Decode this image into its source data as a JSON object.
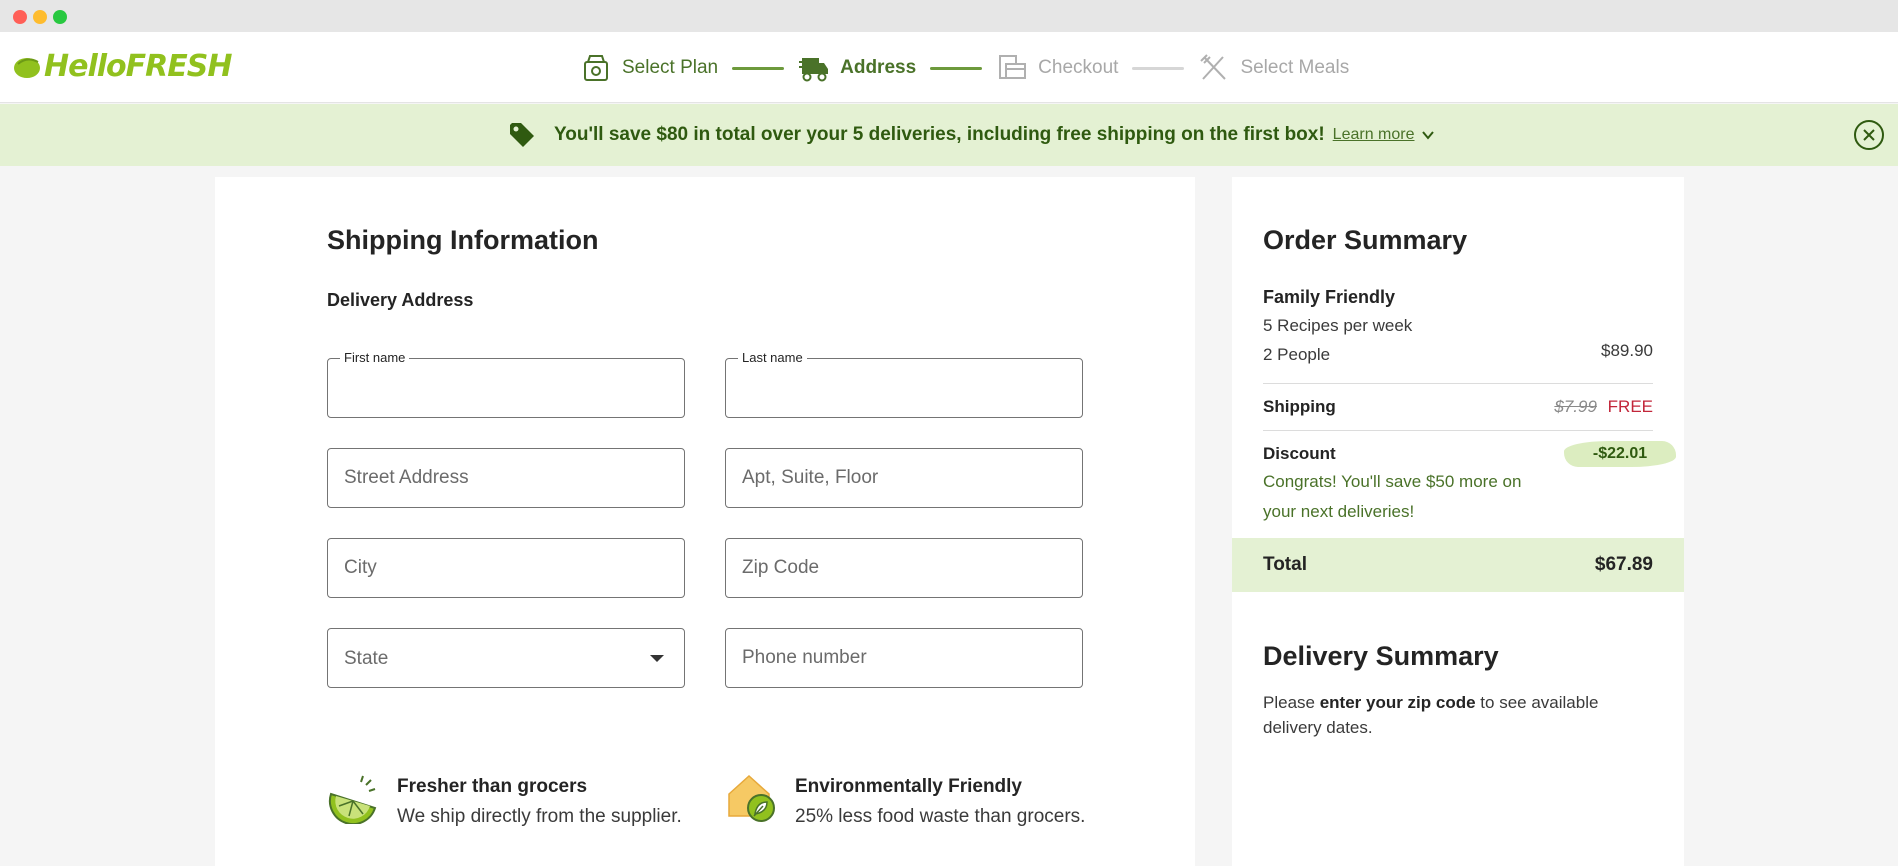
{
  "header": {
    "logo_text": "HelloFRESH",
    "steps": [
      {
        "label": "Select Plan",
        "state": "done",
        "icon": "box-icon"
      },
      {
        "label": "Address",
        "state": "active",
        "icon": "truck-icon"
      },
      {
        "label": "Checkout",
        "state": "pending",
        "icon": "checkout-icon"
      },
      {
        "label": "Select Meals",
        "state": "pending",
        "icon": "utensils-icon"
      }
    ]
  },
  "banner": {
    "text": "You'll save $80 in total over your 5 deliveries, including free shipping on the first box!",
    "learn_more": "Learn more"
  },
  "form": {
    "title": "Shipping Information",
    "section": "Delivery Address",
    "first_name_label": "First name",
    "last_name_label": "Last name",
    "street_placeholder": "Street Address",
    "apt_placeholder": "Apt, Suite, Floor",
    "city_placeholder": "City",
    "zip_placeholder": "Zip Code",
    "state_value": "State",
    "phone_placeholder": "Phone number"
  },
  "features": [
    {
      "title": "Fresher than grocers",
      "desc": "We ship directly from the supplier."
    },
    {
      "title": "Environmentally Friendly",
      "desc": "25% less food waste than grocers."
    }
  ],
  "summary": {
    "title": "Order Summary",
    "plan_name": "Family Friendly",
    "recipes": "5 Recipes per week",
    "people": "2 People",
    "plan_price": "$89.90",
    "shipping_label": "Shipping",
    "shipping_old": "$7.99",
    "shipping_free": "FREE",
    "discount_label": "Discount",
    "discount_value": "-$22.01",
    "congrats": "Congrats! You'll save $50 more on your next deliveries!",
    "total_label": "Total",
    "total_value": "$67.89"
  },
  "delivery": {
    "title": "Delivery Summary",
    "text_pre": "Please ",
    "text_bold": "enter your zip code",
    "text_post": " to see available delivery dates."
  },
  "colors": {
    "brand_green": "#91c11e",
    "dark_green": "#2f5a10",
    "banner_bg": "#e4f1d3",
    "free_red": "#c2263a"
  }
}
